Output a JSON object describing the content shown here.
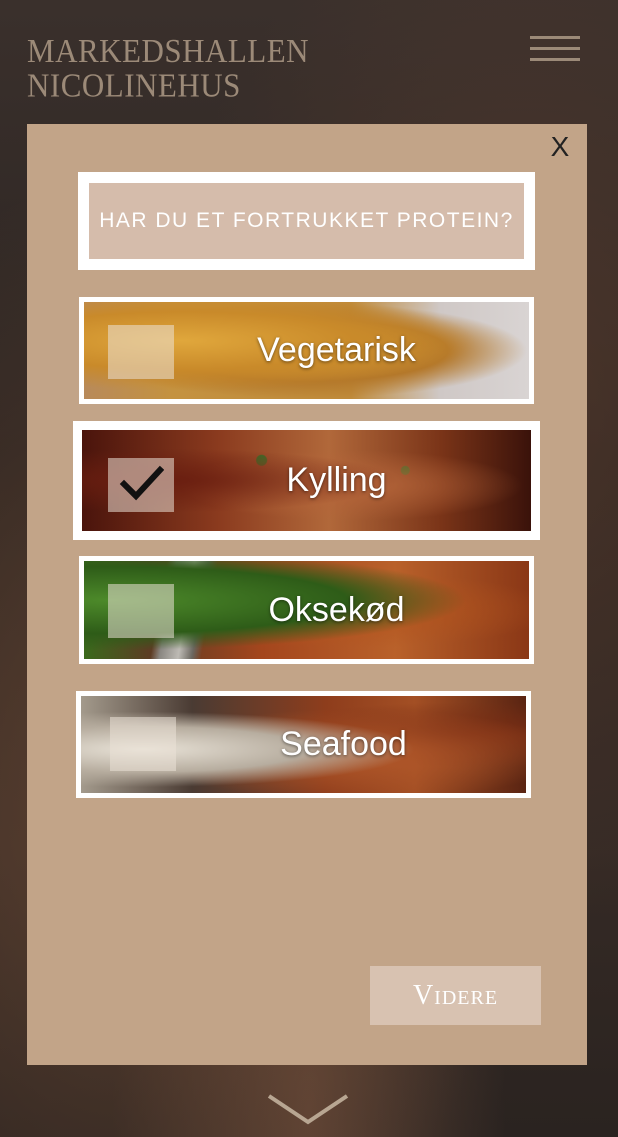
{
  "header": {
    "brand_line1": "MARKEDSHALLEN",
    "brand_line2": "NICOLINEHUS",
    "menu_icon": "hamburger-menu-icon"
  },
  "modal": {
    "close_label": "X",
    "question": "HAR DU ET FORTRUKKET PROTEIN?",
    "options": [
      {
        "label": "Vegetarisk",
        "selected": false
      },
      {
        "label": "Kylling",
        "selected": true
      },
      {
        "label": "Oksekød",
        "selected": false
      },
      {
        "label": "Seafood",
        "selected": false
      }
    ],
    "next_label": "Videre"
  },
  "footer": {
    "scroll_icon": "chevron-down-icon"
  },
  "colors": {
    "modal_bg": "#c2a488",
    "question_bg": "#d5bcab",
    "button_bg": "#d8c2b1",
    "brand_text": "#9c8a78"
  }
}
